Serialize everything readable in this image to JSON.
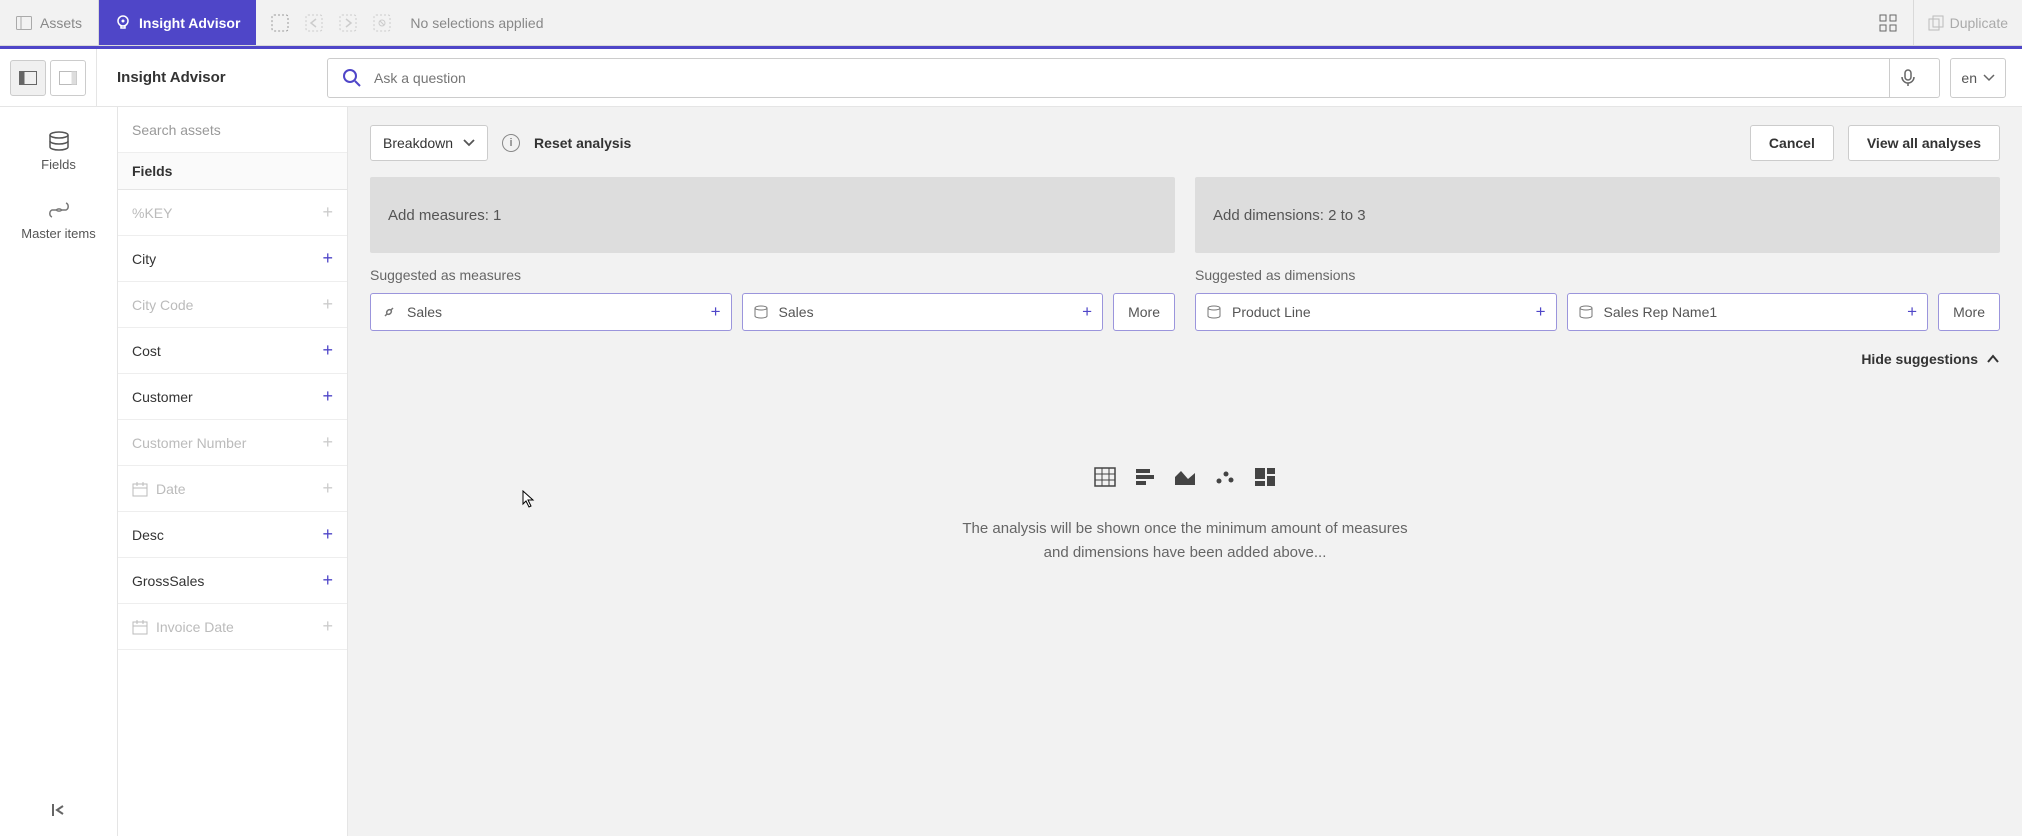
{
  "topbar": {
    "assets_label": "Assets",
    "active_tab": "Insight Advisor",
    "no_selections": "No selections applied",
    "duplicate": "Duplicate"
  },
  "secondbar": {
    "title": "Insight Advisor",
    "search_placeholder": "Ask a question",
    "language": "en"
  },
  "leftnav": {
    "fields": "Fields",
    "master_items": "Master items"
  },
  "fields_panel": {
    "search_placeholder": "Search assets",
    "header": "Fields",
    "items": [
      {
        "label": "%KEY",
        "disabled": true,
        "icon": "none"
      },
      {
        "label": "City",
        "disabled": false,
        "icon": "none"
      },
      {
        "label": "City Code",
        "disabled": true,
        "icon": "none"
      },
      {
        "label": "Cost",
        "disabled": false,
        "icon": "none"
      },
      {
        "label": "Customer",
        "disabled": false,
        "icon": "none"
      },
      {
        "label": "Customer Number",
        "disabled": true,
        "icon": "none"
      },
      {
        "label": "Date",
        "disabled": true,
        "icon": "calendar"
      },
      {
        "label": "Desc",
        "disabled": false,
        "icon": "none"
      },
      {
        "label": "GrossSales",
        "disabled": false,
        "icon": "none"
      },
      {
        "label": "Invoice Date",
        "disabled": true,
        "icon": "calendar"
      }
    ]
  },
  "content": {
    "breakdown_label": "Breakdown",
    "reset_label": "Reset analysis",
    "cancel_label": "Cancel",
    "view_all_label": "View all analyses",
    "measures_zone": "Add measures: 1",
    "dimensions_zone": "Add dimensions: 2 to 3",
    "suggest_measures": "Suggested as measures",
    "suggest_dimensions": "Suggested as dimensions",
    "measure_chips": [
      {
        "label": "Sales",
        "icon": "link"
      },
      {
        "label": "Sales",
        "icon": "db"
      }
    ],
    "dimension_chips": [
      {
        "label": "Product Line",
        "icon": "db"
      },
      {
        "label": "Sales Rep Name1",
        "icon": "db"
      }
    ],
    "more_label": "More",
    "hide_suggestions": "Hide suggestions",
    "placeholder_msg": "The analysis will be shown once the minimum amount of measures and dimensions have been added above..."
  }
}
